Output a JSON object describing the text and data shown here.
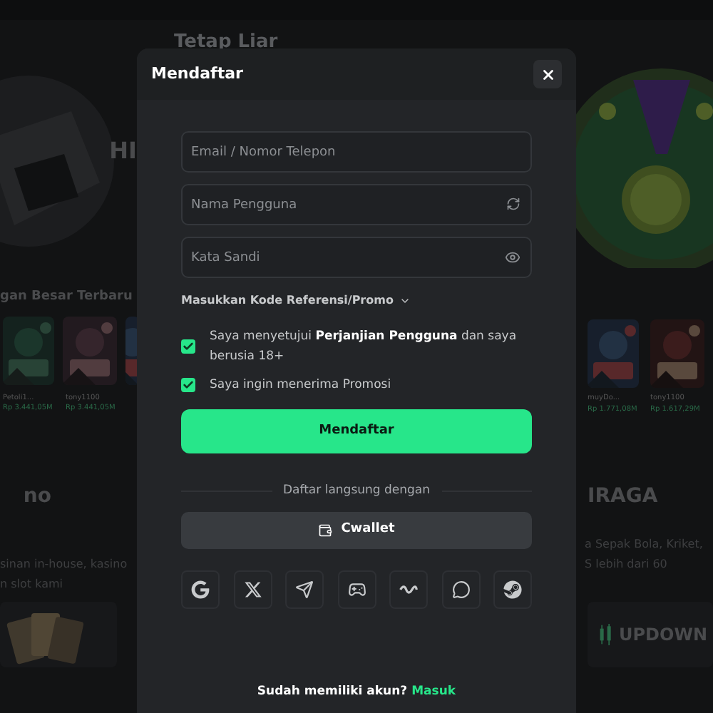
{
  "background": {
    "hero_title": "Tetap Liar",
    "hero_heading": "HI",
    "big_wins_title": "gan Besar Terbaru",
    "left_wins": [
      {
        "user": "Petoli1...",
        "amount": "Rp 3.441,05M"
      },
      {
        "user": "tony1100",
        "amount": "Rp 3.441,05M"
      }
    ],
    "right_wins": [
      {
        "user": "muyDo...",
        "amount": "Rp 1.771,08M"
      },
      {
        "user": "tony1100",
        "amount": "Rp 1.617,29M"
      }
    ],
    "left_section": {
      "title": "no",
      "lines": [
        "sinan in-house, kasino",
        "n slot kami"
      ]
    },
    "right_section": {
      "title": "IRAGA",
      "lines": [
        "a Sepak Bola, Kriket,",
        "S lebih dari 60"
      ]
    },
    "right_card": "UPDOWN"
  },
  "modal": {
    "title": "Mendaftar",
    "fields": [
      {
        "placeholder": "Email / Nomor Telepon",
        "kind": "plain"
      },
      {
        "placeholder": "Nama Pengguna",
        "kind": "refresh"
      },
      {
        "placeholder": "Kata Sandi",
        "kind": "password"
      }
    ],
    "promo_toggle": "Masukkan Kode Referensi/Promo",
    "checks": [
      {
        "label": "Saya menyetujui **Perjanjian Pengguna** dan saya berusia 18+",
        "checked": true
      },
      {
        "label": "Saya ingin menerima Promosi",
        "checked": true
      }
    ],
    "submit": "Mendaftar",
    "divider": "Daftar langsung dengan",
    "wallet_button": "Cwallet",
    "socials": [
      {
        "kind": "google"
      },
      {
        "kind": "x"
      },
      {
        "kind": "telegram"
      },
      {
        "kind": "gamepad"
      },
      {
        "kind": "wave"
      },
      {
        "kind": "chat"
      },
      {
        "kind": "steam"
      }
    ],
    "login_prompt": "Sudah memiliki akun?",
    "login_link": "Masuk"
  }
}
